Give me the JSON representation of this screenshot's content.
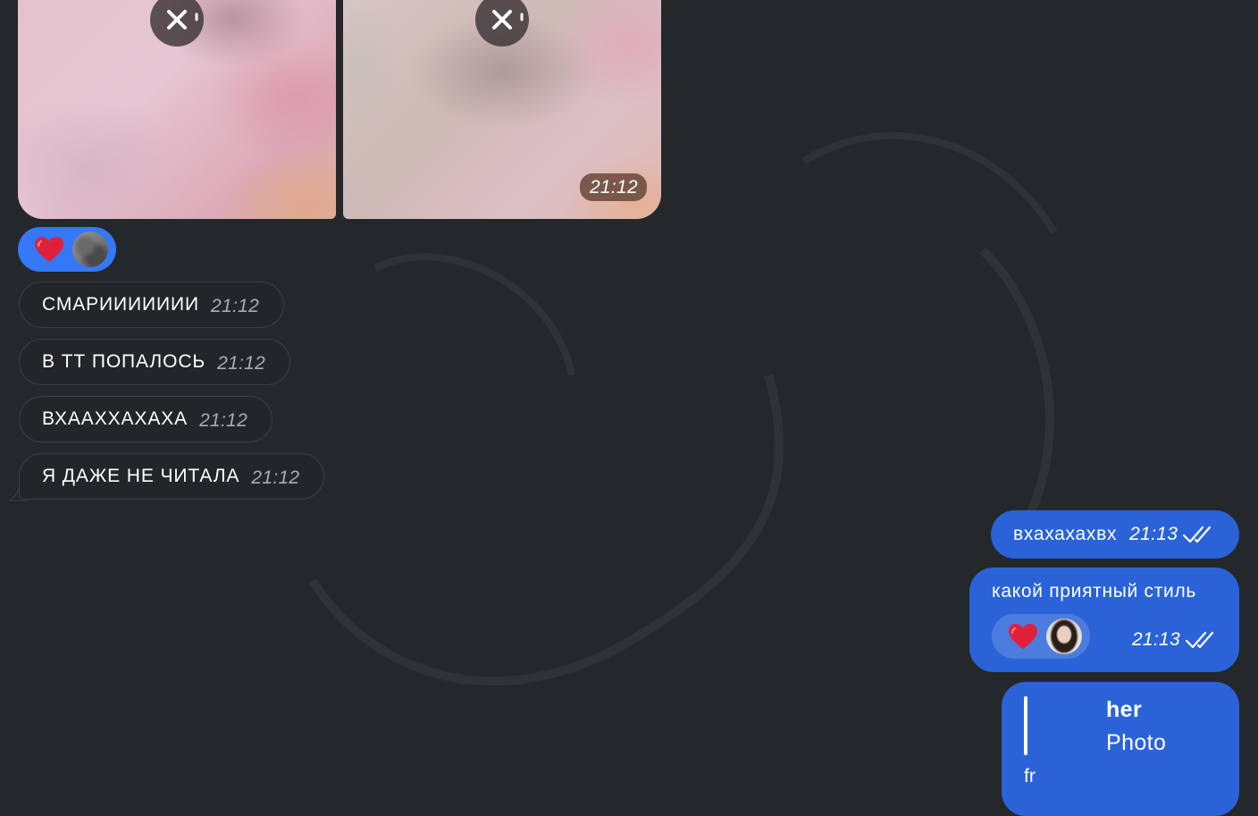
{
  "album": {
    "time": "21:12"
  },
  "reactions": {
    "album_heart": "♥",
    "msg_heart": "♥"
  },
  "incoming": [
    {
      "text": "СМАРИИИИИИИ",
      "time": "21:12"
    },
    {
      "text": "В ТТ ПОПАЛОСЬ",
      "time": "21:12"
    },
    {
      "text": "ВХААХХАХАХА",
      "time": "21:12"
    },
    {
      "text": "Я ДАЖЕ НЕ ЧИТАЛА",
      "time": "21:12"
    }
  ],
  "outgoing": [
    {
      "text": "вхахахахвх",
      "time": "21:13"
    },
    {
      "text": "какой приятный стиль",
      "time": "21:13"
    }
  ],
  "reply": {
    "name": "her",
    "snippet": "Photo",
    "text": "fr"
  },
  "colors": {
    "background": "#24282b",
    "outgoing_bubble": "#2a63d8",
    "reaction_pill": "#3478f6",
    "incoming_border": "#3c4043",
    "heart": "#e0203a"
  }
}
